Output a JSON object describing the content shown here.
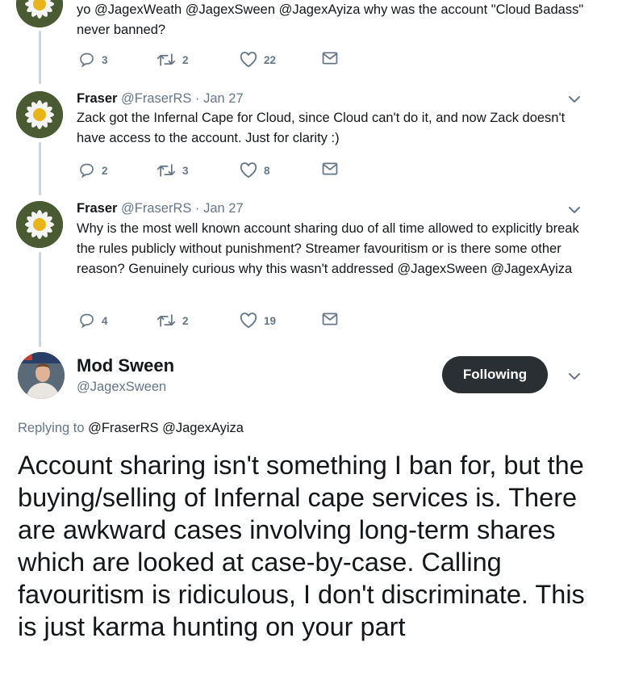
{
  "tweets": [
    {
      "text": "yo @JagexWeath @JagexSween @JagexAyiza why was the account \"Cloud Badass\" never banned?",
      "replies": "3",
      "retweets": "2",
      "likes": "22"
    },
    {
      "name": "Fraser",
      "handle": "@FraserRS",
      "sep": "·",
      "date": "Jan 27",
      "text": "Zack got the Infernal Cape for Cloud, since Cloud can't do it, and now Zack doesn't have access to the account. Just for clarity :)",
      "replies": "2",
      "retweets": "3",
      "likes": "8"
    },
    {
      "name": "Fraser",
      "handle": "@FraserRS",
      "sep": "·",
      "date": "Jan 27",
      "text": "Why is the most well known account sharing duo of all time allowed to explicitly break the rules publicly without punishment? Streamer favouritism or is there some other reason? Genuinely curious why this wasn't addressed @JagexSween @JagexAyiza",
      "replies": "4",
      "retweets": "2",
      "likes": "19"
    }
  ],
  "main_tweet": {
    "name": "Mod Sween",
    "handle": "@JagexSween",
    "follow_label": "Following",
    "replying_prefix": "Replying to",
    "replying_to": [
      "@FraserRS",
      "@JagexAyiza"
    ],
    "text": "Account sharing isn't something I ban for, but the buying/selling of Infernal cape services is. There are awkward cases involving long-term shares which are looked at case-by-case. Calling favouritism is ridiculous, I don't discriminate. This is just karma hunting on your part"
  },
  "icons": {
    "reply": "reply-icon",
    "retweet": "retweet-icon",
    "like": "heart-icon",
    "dm": "envelope-icon",
    "more": "chevron-down-icon"
  },
  "colors": {
    "secondary_text": "#657786",
    "link": "#1b95e0",
    "button_bg": "#292f33",
    "thread_line": "#ccd6dd"
  }
}
